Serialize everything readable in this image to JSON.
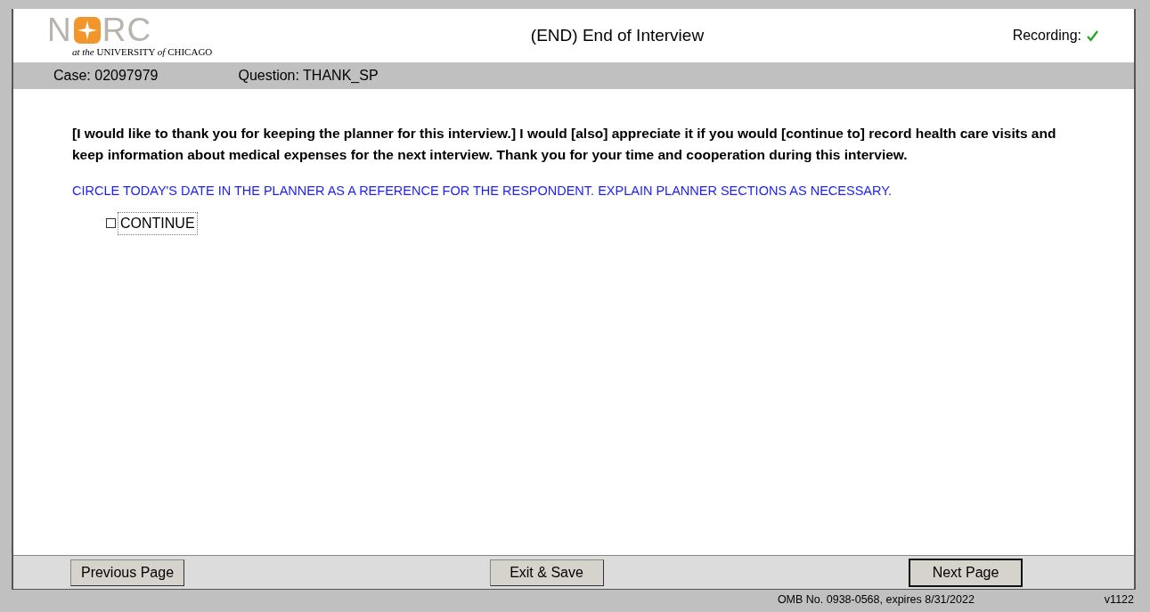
{
  "logo": {
    "before": "N",
    "after": "RC",
    "tagline": "*at the* UNIVERSITY *of* CHICAGO"
  },
  "window": {
    "title": "(END) End of Interview"
  },
  "recording": {
    "label": "Recording:",
    "on": true
  },
  "info_bar": {
    "case": "Case: 02097979",
    "question": "Question: THANK_SP"
  },
  "question_text": "[I would like to thank you for keeping the planner for this interview.] I would [also] appreciate it if you would [continue to] record health care visits and keep information about medical expenses for the next interview.  Thank you for your time and cooperation during this interview.",
  "instruction": "CIRCLE TODAY'S DATE IN THE PLANNER AS A REFERENCE FOR THE RESPONDENT. EXPLAIN PLANNER SECTIONS AS NECESSARY.",
  "options": [
    {
      "label": "CONTINUE",
      "checked": false,
      "focused": true
    }
  ],
  "buttons": [
    {
      "label": "Previous Page",
      "default": false
    },
    {
      "label": "Exit & Save",
      "default": false
    },
    {
      "label": "Next Page",
      "default": true
    }
  ],
  "status_bar": {
    "omb": "OMB No. 0938-0568, expires 8/31/2022",
    "version": "v1122"
  }
}
